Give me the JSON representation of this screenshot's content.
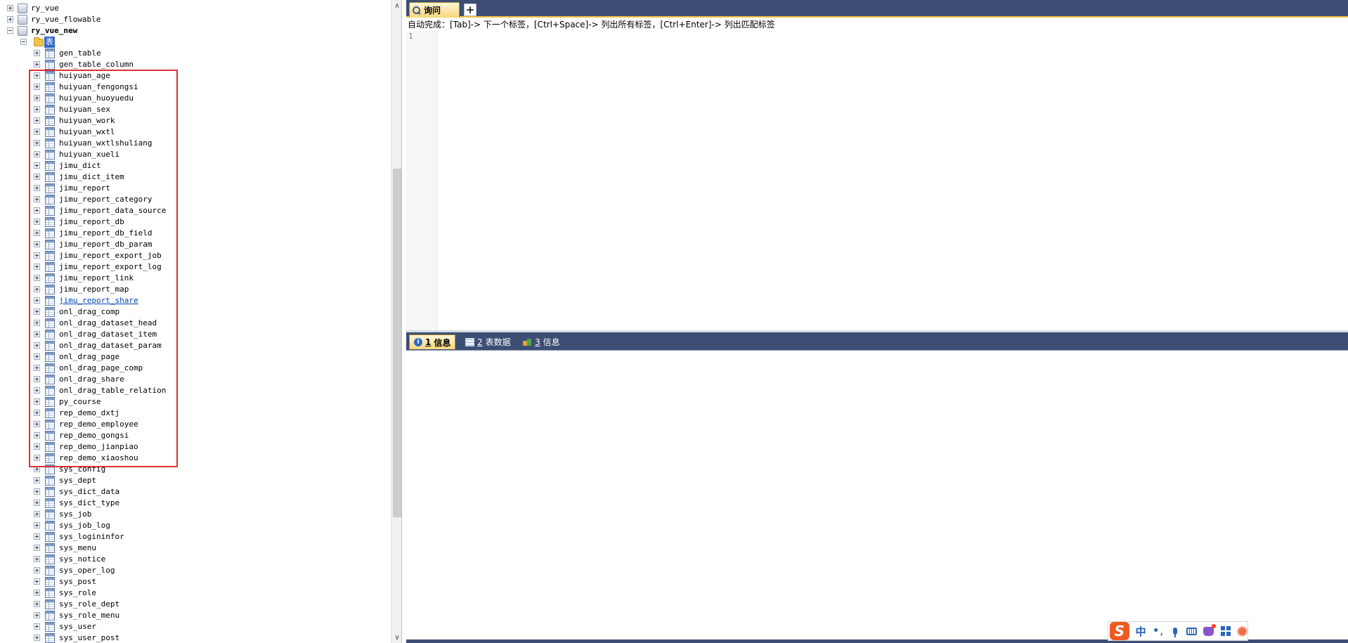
{
  "tree": {
    "databases": [
      "ry_vue",
      "ry_vue_flowable",
      "ry_vue_new"
    ],
    "folder_label": "表",
    "tables": [
      "gen_table",
      "gen_table_column",
      "huiyuan_age",
      "huiyuan_fengongsi",
      "huiyuan_huoyuedu",
      "huiyuan_sex",
      "huiyuan_work",
      "huiyuan_wxtl",
      "huiyuan_wxtlshuliang",
      "huiyuan_xueli",
      "jimu_dict",
      "jimu_dict_item",
      "jimu_report",
      "jimu_report_category",
      "jimu_report_data_source",
      "jimu_report_db",
      "jimu_report_db_field",
      "jimu_report_db_param",
      "jimu_report_export_job",
      "jimu_report_export_log",
      "jimu_report_link",
      "jimu_report_map",
      "jimu_report_share",
      "onl_drag_comp",
      "onl_drag_dataset_head",
      "onl_drag_dataset_item",
      "onl_drag_dataset_param",
      "onl_drag_page",
      "onl_drag_page_comp",
      "onl_drag_share",
      "onl_drag_table_relation",
      "py_course",
      "rep_demo_dxtj",
      "rep_demo_employee",
      "rep_demo_gongsi",
      "rep_demo_jianpiao",
      "rep_demo_xiaoshou",
      "sys_config",
      "sys_dept",
      "sys_dict_data",
      "sys_dict_type",
      "sys_job",
      "sys_job_log",
      "sys_logininfor",
      "sys_menu",
      "sys_notice",
      "sys_oper_log",
      "sys_post",
      "sys_role",
      "sys_role_dept",
      "sys_role_menu",
      "sys_user",
      "sys_user_post"
    ],
    "hovered_table": "jimu_report_share"
  },
  "editor": {
    "tab_label": "询问",
    "add_tab_label": "+",
    "hint": "自动完成：[Tab]-> 下一个标签，[Ctrl+Space]-> 列出所有标签，[Ctrl+Enter]-> 列出匹配标签",
    "line_number": "1"
  },
  "results": {
    "tabs": [
      {
        "num": "1",
        "label": "信息"
      },
      {
        "num": "2",
        "label": "表数据"
      },
      {
        "num": "3",
        "label": "信息"
      }
    ]
  },
  "ime": {
    "logo_letter": "S",
    "lang": "中",
    "punct": "•,"
  },
  "colors": {
    "selection": "#316ac5",
    "highlight_box": "#e0302f",
    "tab_bar": "#3c4e73",
    "active_tab": "#f6d77a"
  }
}
